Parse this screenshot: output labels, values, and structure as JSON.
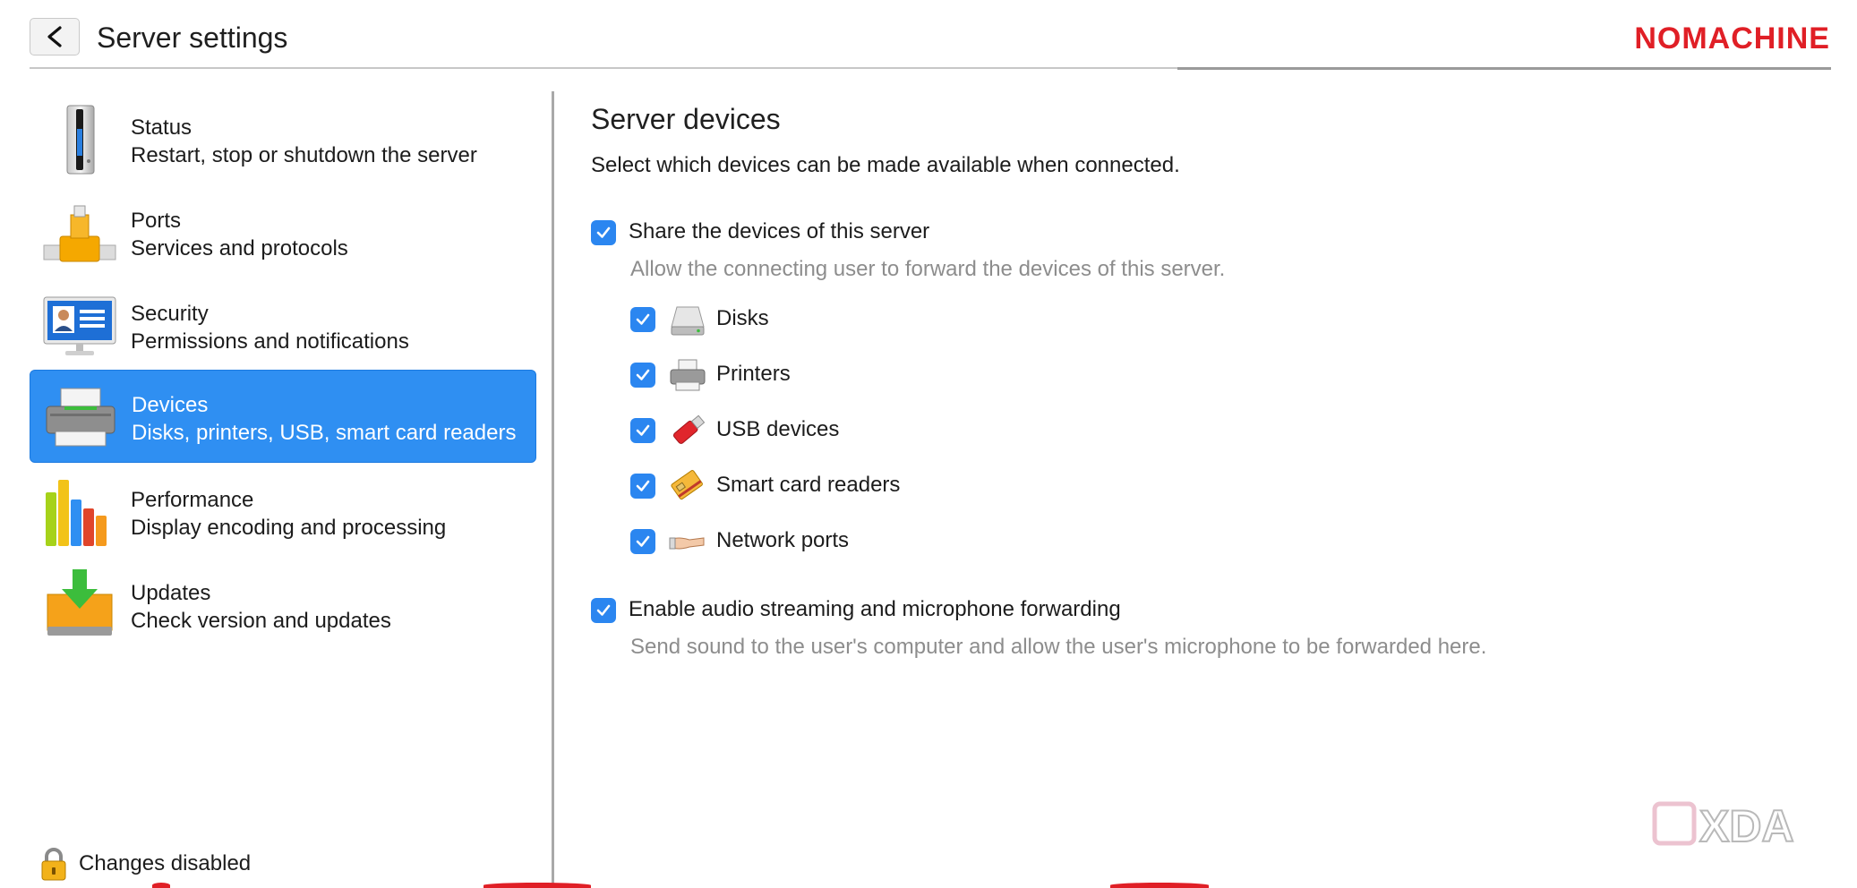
{
  "header": {
    "back_label": "<",
    "title": "Server settings",
    "brand": "NOMACHINE",
    "brand_color": "#e01f26"
  },
  "sidebar": {
    "items": [
      {
        "title": "Status",
        "subtitle": "Restart, stop or shutdown the server",
        "icon": "server-tower-icon",
        "selected": false
      },
      {
        "title": "Ports",
        "subtitle": "Services and protocols",
        "icon": "network-port-icon",
        "selected": false
      },
      {
        "title": "Security",
        "subtitle": "Permissions and notifications",
        "icon": "id-card-monitor-icon",
        "selected": false
      },
      {
        "title": "Devices",
        "subtitle": "Disks, printers, USB, smart card readers",
        "icon": "printer-icon",
        "selected": true
      },
      {
        "title": "Performance",
        "subtitle": "Display encoding and processing",
        "icon": "bar-chart-icon",
        "selected": false
      },
      {
        "title": "Updates",
        "subtitle": "Check version and updates",
        "icon": "download-box-icon",
        "selected": false
      }
    ],
    "selected_color": "#2f8ff2",
    "footer": {
      "icon": "lock-icon",
      "label": "Changes disabled"
    }
  },
  "main": {
    "title": "Server devices",
    "description": "Select which devices can be made available when connected.",
    "share": {
      "label": "Share the devices of this server",
      "checked": true,
      "hint": "Allow the connecting user to forward the devices of this server."
    },
    "devices": [
      {
        "label": "Disks",
        "icon": "disk-drive-icon",
        "checked": true
      },
      {
        "label": "Printers",
        "icon": "printer-small-icon",
        "checked": true
      },
      {
        "label": "USB devices",
        "icon": "usb-stick-icon",
        "checked": true
      },
      {
        "label": "Smart card readers",
        "icon": "smart-card-icon",
        "checked": true
      },
      {
        "label": "Network ports",
        "icon": "network-cable-icon",
        "checked": true
      }
    ],
    "audio": {
      "label": "Enable audio streaming and microphone forwarding",
      "checked": true,
      "hint": "Send sound to the user's computer and allow the user's microphone to be forwarded here."
    }
  },
  "watermark": "XDA",
  "checkbox_color": "#2b86f0"
}
